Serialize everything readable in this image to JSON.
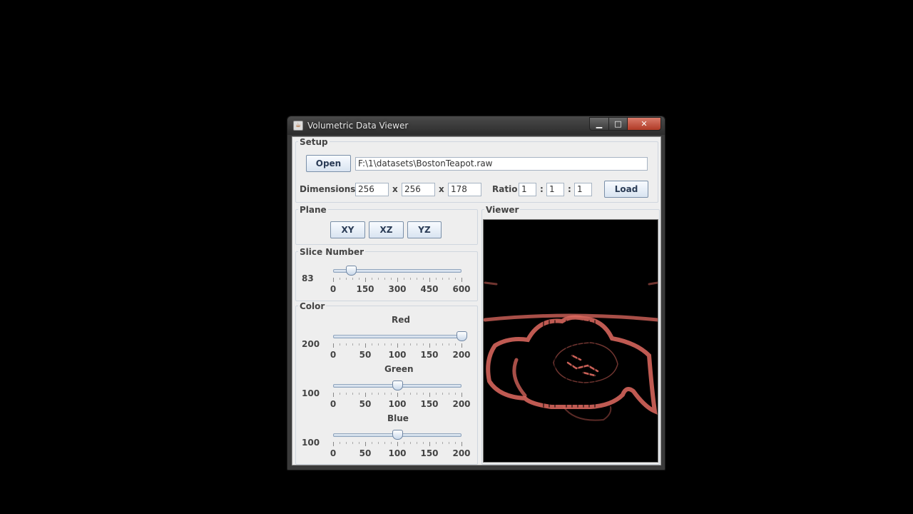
{
  "window": {
    "title": "Volumetric Data Viewer",
    "minimize": "▁",
    "maximize": "□",
    "close": "✕"
  },
  "setup": {
    "legend": "Setup",
    "open_label": "Open",
    "file_path": "F:\\1\\datasets\\BostonTeapot.raw",
    "dimensions_label": "Dimensions",
    "dim_x": "256",
    "dim_y": "256",
    "dim_z": "178",
    "x_sep": "x",
    "ratio_label": "Ratio",
    "ratio_a": "1",
    "ratio_b": "1",
    "ratio_c": "1",
    "colon": ":",
    "load_label": "Load"
  },
  "plane": {
    "legend": "Plane",
    "buttons": [
      "XY",
      "XZ",
      "YZ"
    ]
  },
  "slice": {
    "legend": "Slice Number",
    "value": "83",
    "min": 0,
    "max": 600,
    "current": 83,
    "tick_labels": [
      "0",
      "150",
      "300",
      "450",
      "600"
    ]
  },
  "color": {
    "legend": "Color",
    "red": {
      "label": "Red",
      "value": "200",
      "current": 200
    },
    "green": {
      "label": "Green",
      "value": "100",
      "current": 100
    },
    "blue": {
      "label": "Blue",
      "value": "100",
      "current": 100
    },
    "min": 0,
    "max": 200,
    "tick_labels": [
      "0",
      "50",
      "100",
      "150",
      "200"
    ]
  },
  "viewer": {
    "legend": "Viewer",
    "render_color": "#e06a60"
  }
}
